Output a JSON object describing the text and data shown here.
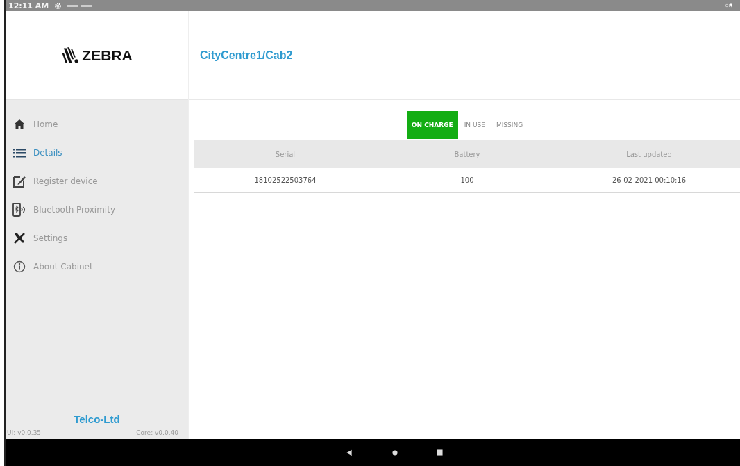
{
  "status_bar": {
    "time": "12:11 AM"
  },
  "logo": {
    "text": "ZEBRA"
  },
  "header": {
    "title": "CityCentre1/Cab2"
  },
  "sidebar": {
    "items": [
      {
        "label": "Home",
        "selected": false
      },
      {
        "label": "Details",
        "selected": true
      },
      {
        "label": "Register device",
        "selected": false
      },
      {
        "label": "Bluetooth Proximity",
        "selected": false
      },
      {
        "label": "Settings",
        "selected": false
      },
      {
        "label": "About Cabinet",
        "selected": false
      }
    ],
    "company": "Telco-Ltd",
    "ui_version": "UI: v0.0.35",
    "core_version": "Core: v0.0.40"
  },
  "tabs": [
    {
      "label": "ON CHARGE",
      "selected": true
    },
    {
      "label": "IN USE",
      "selected": false
    },
    {
      "label": "MISSING",
      "selected": false
    }
  ],
  "table": {
    "columns": [
      "Serial",
      "Battery",
      "Last updated"
    ],
    "rows": [
      [
        "18102522503764",
        "100",
        "26-02-2021 00:10:16"
      ]
    ]
  }
}
